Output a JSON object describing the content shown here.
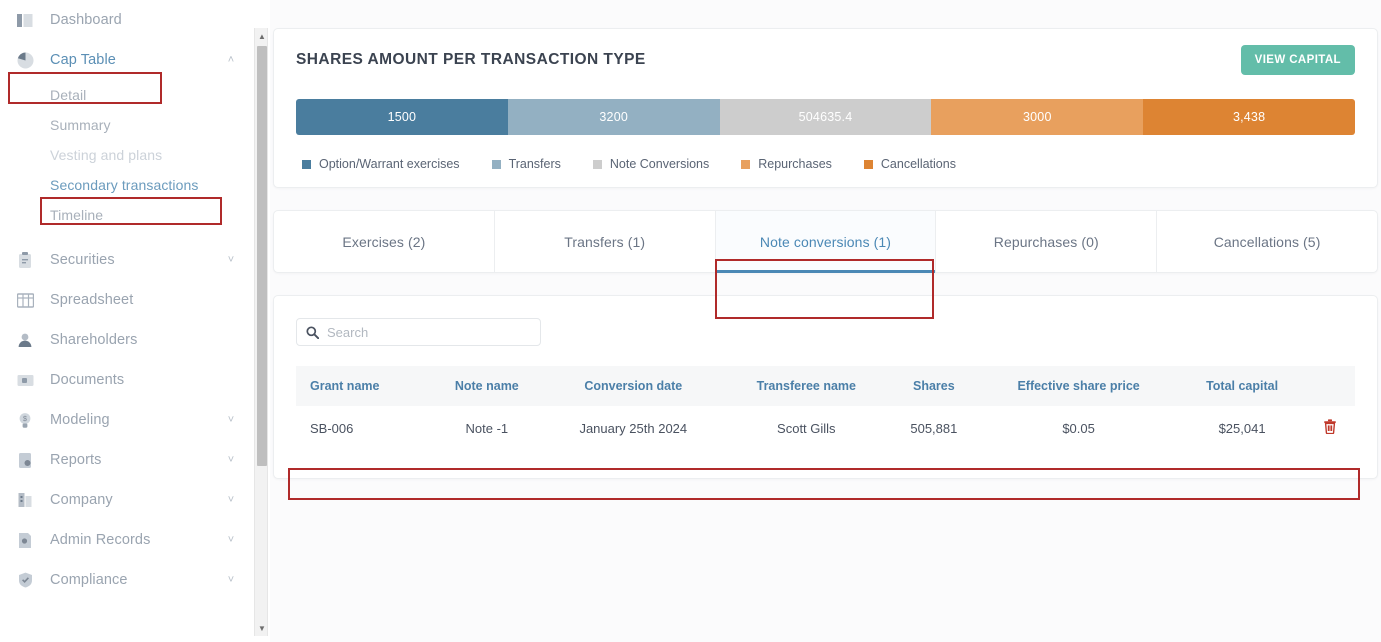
{
  "sidebar": {
    "items": [
      {
        "label": "Dashboard",
        "icon": "dashboard-icon",
        "expandable": false,
        "active": false
      },
      {
        "label": "Cap Table",
        "icon": "pie-chart-icon",
        "expandable": true,
        "chevron": "˄",
        "active": true
      },
      {
        "label": "Securities",
        "icon": "clipboard-icon",
        "expandable": true,
        "chevron": "˅",
        "active": false
      },
      {
        "label": "Spreadsheet",
        "icon": "grid-icon",
        "expandable": false,
        "active": false
      },
      {
        "label": "Shareholders",
        "icon": "user-icon",
        "expandable": false,
        "active": false
      },
      {
        "label": "Documents",
        "icon": "folder-icon",
        "expandable": false,
        "active": false
      },
      {
        "label": "Modeling",
        "icon": "lightbulb-icon",
        "expandable": true,
        "chevron": "˅",
        "active": false
      },
      {
        "label": "Reports",
        "icon": "report-icon",
        "expandable": true,
        "chevron": "˅",
        "active": false
      },
      {
        "label": "Company",
        "icon": "building-icon",
        "expandable": true,
        "chevron": "˅",
        "active": false
      },
      {
        "label": "Admin Records",
        "icon": "admin-icon",
        "expandable": true,
        "chevron": "˅",
        "active": false
      },
      {
        "label": "Compliance",
        "icon": "shield-check-icon",
        "expandable": true,
        "chevron": "˅",
        "active": false
      }
    ],
    "cap_table_children": [
      {
        "label": "Detail",
        "state": "normal"
      },
      {
        "label": "Summary",
        "state": "normal"
      },
      {
        "label": "Vesting and plans",
        "state": "muted"
      },
      {
        "label": "Secondary transactions",
        "state": "link"
      },
      {
        "label": "Timeline",
        "state": "normal"
      }
    ],
    "scrollbar": {
      "up_arrow": "▲",
      "down_arrow": "▼"
    }
  },
  "chart_card": {
    "title": "SHARES AMOUNT PER TRANSACTION TYPE",
    "view_capital_label": "VIEW CAPITAL",
    "view_capital_color": "#63bda9"
  },
  "chart_data": {
    "type": "bar",
    "title": "SHARES AMOUNT PER TRANSACTION TYPE",
    "orientation": "horizontal-stacked",
    "categories": [
      "Option/Warrant exercises",
      "Transfers",
      "Note Conversions",
      "Repurchases",
      "Cancellations"
    ],
    "labels": [
      "1500",
      "3200",
      "504635.4",
      "3000",
      "3,438"
    ],
    "values": [
      1500,
      3200,
      504635.4,
      3000,
      3438
    ],
    "colors": [
      "#4a7d9e",
      "#93b0c2",
      "#cdcdcd",
      "#e8a05e",
      "#dd8433"
    ],
    "legend": [
      {
        "label": "Option/Warrant exercises",
        "color": "#4a7d9e"
      },
      {
        "label": "Transfers",
        "color": "#93b0c2"
      },
      {
        "label": "Note Conversions",
        "color": "#cdcdcd"
      },
      {
        "label": "Repurchases",
        "color": "#e8a05e"
      },
      {
        "label": "Cancellations",
        "color": "#dd8433"
      }
    ],
    "legend_position": "bottom",
    "grid": false,
    "xlabel": "",
    "ylabel": ""
  },
  "tabs": [
    {
      "label": "Exercises (2)",
      "active": false
    },
    {
      "label": "Transfers (1)",
      "active": false
    },
    {
      "label": "Note conversions (1)",
      "active": true
    },
    {
      "label": "Repurchases (0)",
      "active": false
    },
    {
      "label": "Cancellations (5)",
      "active": false
    }
  ],
  "search": {
    "placeholder": "Search",
    "value": "",
    "icon": "search-icon"
  },
  "table": {
    "columns": [
      "Grant name",
      "Note name",
      "Conversion date",
      "Transferee name",
      "Shares",
      "Effective share price",
      "Total capital",
      ""
    ],
    "rows": [
      {
        "grant_name": "SB-006",
        "note_name": "Note -1",
        "conversion_date": "January 25th 2024",
        "transferee_name": "Scott Gills",
        "shares": "505,881",
        "effective_share_price": "$0.05",
        "total_capital": "$25,041",
        "delete_icon": "trash-icon"
      }
    ]
  },
  "annotations": {
    "color": "#b02a2a",
    "boxes": [
      "cap-table-nav",
      "secondary-transactions-nav",
      "note-conversions-tab",
      "table-row"
    ]
  }
}
